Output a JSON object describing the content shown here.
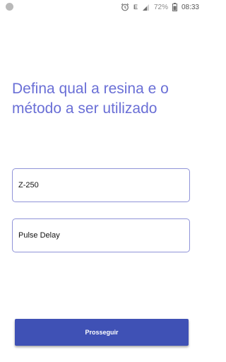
{
  "status_bar": {
    "network_type": "E",
    "battery": "72%",
    "time": "08:33",
    "icons": [
      "notification-dot-icon",
      "alarm-icon",
      "signal-icon",
      "battery-icon"
    ]
  },
  "main": {
    "title": "Defina qual a resina e o método a ser utilizado",
    "resin_field": {
      "value": "Z-250"
    },
    "method_field": {
      "value": "Pulse Delay"
    },
    "continue_button": {
      "label": "Prosseguir"
    }
  },
  "colors": {
    "accent": "#3f51b5",
    "title": "#6a6fd6",
    "field_border": "#8f93d8"
  }
}
